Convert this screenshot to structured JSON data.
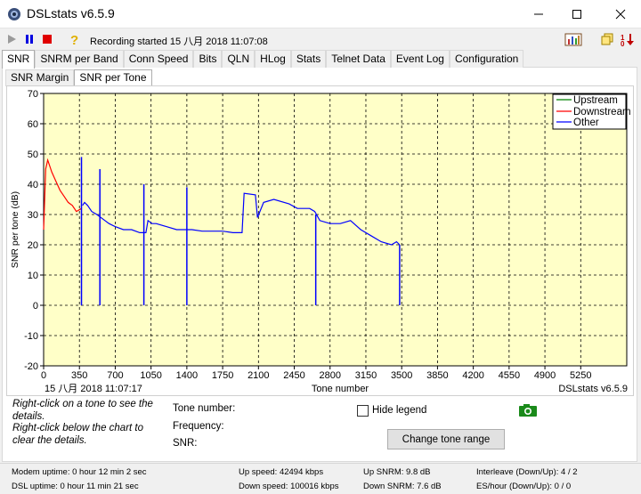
{
  "window": {
    "title": "DSLstats v6.5.9"
  },
  "toolbar": {
    "status": "Recording started 15 八月 2018 11:07:08"
  },
  "tabs": [
    "SNR",
    "SNRM per Band",
    "Conn Speed",
    "Bits",
    "QLN",
    "HLog",
    "Stats",
    "Telnet Data",
    "Event Log",
    "Configuration"
  ],
  "subtabs": [
    "SNR Margin",
    "SNR per Tone"
  ],
  "chart": {
    "ylabel": "SNR per tone (dB)",
    "xlabel": "Tone number",
    "timestamp": "15 八月 2018 11:07:17",
    "watermark": "DSLstats v6.5.9",
    "legend": [
      "Upstream",
      "Downstream",
      "Other"
    ]
  },
  "chart_data": {
    "type": "line",
    "title": "",
    "xlabel": "Tone number",
    "ylabel": "SNR per tone (dB)",
    "xlim": [
      0,
      5700
    ],
    "ylim": [
      -20,
      70
    ],
    "x_ticks": [
      0,
      350,
      700,
      1050,
      1400,
      1750,
      2100,
      2450,
      2800,
      3150,
      3500,
      3850,
      4200,
      4550,
      4900,
      5250
    ],
    "y_ticks": [
      -20,
      -10,
      0,
      10,
      20,
      30,
      40,
      50,
      60,
      70
    ],
    "grid": true,
    "legend_position": "top-right",
    "colors": {
      "Upstream": "#008000",
      "Downstream": "#ff0000",
      "Other": "#0000ff"
    },
    "series": [
      {
        "name": "Upstream",
        "x": [],
        "y": []
      },
      {
        "name": "Downstream",
        "x": [
          0,
          20,
          40,
          80,
          120,
          160,
          200,
          240,
          280,
          320,
          370
        ],
        "y": [
          25,
          45,
          48,
          44,
          41,
          38,
          36,
          34,
          33,
          31,
          32
        ]
      },
      {
        "name": "Other",
        "x": [
          380,
          400,
          430,
          470,
          520,
          600,
          640,
          700,
          780,
          860,
          940,
          1000,
          1020,
          1060,
          1100,
          1200,
          1300,
          1380,
          1450,
          1550,
          1650,
          1750,
          1850,
          1940,
          1960,
          2070,
          2090,
          2150,
          2250,
          2400,
          2480,
          2600,
          2650,
          2700,
          2800,
          2900,
          3000,
          3100,
          3200,
          3300,
          3400,
          3450,
          3480
        ],
        "y": [
          33,
          34,
          33,
          31,
          30,
          28,
          27,
          26,
          25,
          25,
          24,
          24,
          28,
          27,
          27,
          26,
          25,
          25,
          25,
          24.5,
          24.5,
          24.5,
          24,
          24,
          37,
          36.5,
          29,
          34,
          35,
          33.5,
          32,
          32,
          31,
          28,
          27,
          27,
          28,
          25,
          23,
          21,
          20,
          21,
          20
        ]
      }
    ],
    "spikes": [
      {
        "x": 370,
        "y": 49
      },
      {
        "x": 550,
        "y": 45
      },
      {
        "x": 980,
        "y": 40
      },
      {
        "x": 1400,
        "y": 39
      },
      {
        "x": 2660,
        "y": 30
      },
      {
        "x": 3480,
        "y": 20
      }
    ]
  },
  "info": {
    "hint1": "Right-click on a tone to see the details.",
    "hint2": "Right-click below the chart to clear the details.",
    "tone_label": "Tone number:",
    "freq_label": "Frequency:",
    "snr_label": "SNR:",
    "hide_legend": "Hide legend",
    "change_range": "Change tone range"
  },
  "status": {
    "modem_uptime": "Modem uptime:  0 hour 12 min 2 sec",
    "dsl_uptime": "DSL uptime:  0 hour 11 min 21 sec",
    "up_speed": "Up speed: 42494 kbps",
    "down_speed": "Down speed: 100016 kbps",
    "up_snrm": "Up SNRM: 9.8 dB",
    "down_snrm": "Down SNRM: 7.6 dB",
    "interleave": "Interleave (Down/Up): 4 / 2",
    "es_hour": "ES/hour (Down/Up): 0 / 0"
  }
}
